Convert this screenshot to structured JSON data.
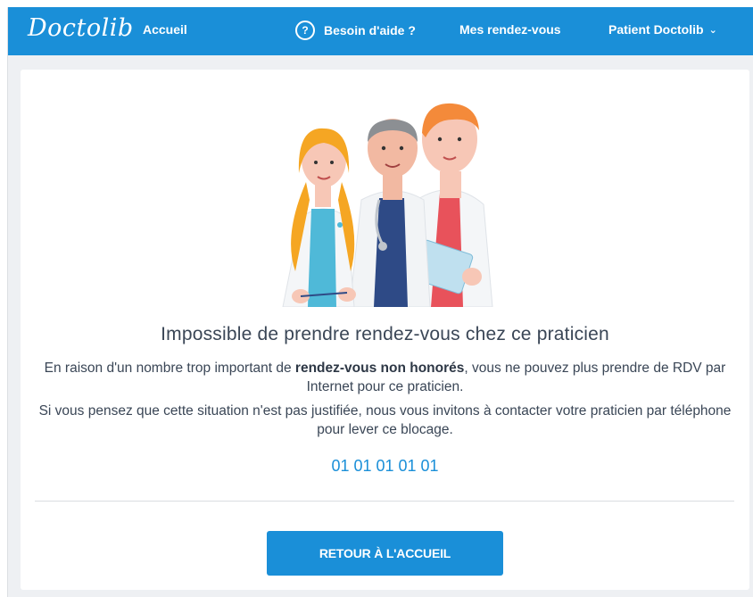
{
  "navbar": {
    "logo": "Doctolib",
    "accueil": "Accueil",
    "help_icon": "?",
    "help": "Besoin d'aide ?",
    "rdv": "Mes rendez-vous",
    "patient": "Patient Doctolib",
    "patient_chevron": "⌄"
  },
  "main": {
    "title": "Impossible de prendre rendez-vous chez ce praticien",
    "para1_prefix": "En raison d'un nombre trop important de ",
    "para1_bold": "rendez-vous non honorés",
    "para1_suffix": ", vous ne pouvez plus prendre de RDV par Internet pour ce praticien.",
    "para2": "Si vous pensez que cette situation n'est pas justifiée, nous vous invitons à contacter votre praticien par téléphone pour lever ce blocage.",
    "phone": "01 01 01 01 01",
    "button": "RETOUR À L'ACCUEIL"
  },
  "colors": {
    "brand": "#1a8fd8",
    "text": "#3a4656",
    "background": "#eef0f3"
  }
}
